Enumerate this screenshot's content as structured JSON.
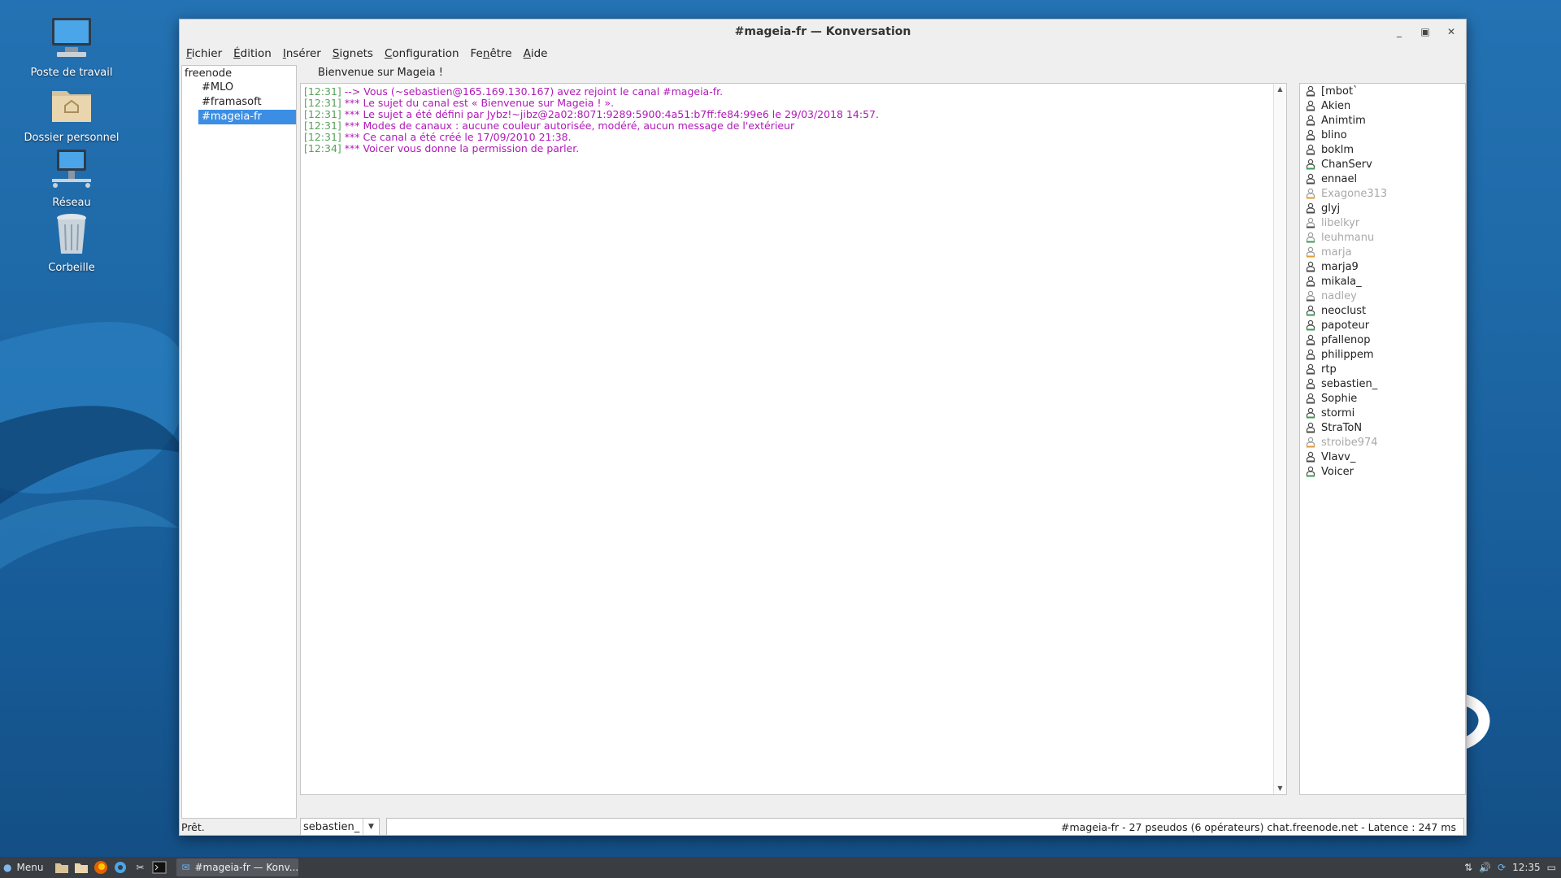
{
  "desktop": {
    "icons": [
      {
        "label": "Poste de travail",
        "icon": "computer-icon"
      },
      {
        "label": "Dossier personnel",
        "icon": "home-folder-icon"
      },
      {
        "label": "Réseau",
        "icon": "network-icon"
      },
      {
        "label": "Corbeille",
        "icon": "trash-icon"
      }
    ]
  },
  "window": {
    "title": "#mageia-fr — Konversation",
    "controls": [
      "minimize",
      "maximize",
      "close"
    ]
  },
  "menubar": [
    {
      "accel": "F",
      "rest": "ichier"
    },
    {
      "accel": "É",
      "rest": "dition"
    },
    {
      "accel": "I",
      "rest": "nsérer"
    },
    {
      "accel": "S",
      "rest": "ignets"
    },
    {
      "accel": "C",
      "rest": "onfiguration"
    },
    {
      "accel": "F",
      "rest": "enêtre",
      "pre": "Fe",
      "accel2": "n"
    },
    {
      "accel": "A",
      "rest": "ide"
    }
  ],
  "tree": {
    "server": "freenode",
    "channels": [
      "#MLO",
      "#framasoft",
      "#mageia-fr"
    ],
    "selected": "#mageia-fr"
  },
  "topic": "Bienvenue sur Mageia !",
  "chat": {
    "lines": [
      {
        "time": "[12:31]",
        "text": "--> Vous (~sebastien@165.169.130.167) avez rejoint le canal #mageia-fr."
      },
      {
        "time": "[12:31]",
        "text": "*** Le sujet du canal est « Bienvenue sur Mageia ! »."
      },
      {
        "time": "[12:31]",
        "text": "*** Le sujet a été défini par Jybz!~jibz@2a02:8071:9289:5900:4a51:b7ff:fe84:99e6 le 29/03/2018 14:57."
      },
      {
        "time": "[12:31]",
        "text": "*** Modes de canaux : aucune couleur autorisée, modéré, aucun message de l'extérieur"
      },
      {
        "time": "[12:31]",
        "text": "*** Ce canal a été créé le 17/09/2010 21:38."
      },
      {
        "time": "[12:34]",
        "text": "*** Voicer vous donne la permission de parler."
      }
    ]
  },
  "nicklist": [
    {
      "nick": "[mbot`",
      "away": false,
      "mode": "normal"
    },
    {
      "nick": "Akien",
      "away": false,
      "mode": "normal"
    },
    {
      "nick": "Animtim",
      "away": false,
      "mode": "normal"
    },
    {
      "nick": "blino",
      "away": false,
      "mode": "normal"
    },
    {
      "nick": "boklm",
      "away": false,
      "mode": "normal"
    },
    {
      "nick": "ChanServ",
      "away": false,
      "mode": "op"
    },
    {
      "nick": "ennael",
      "away": false,
      "mode": "normal"
    },
    {
      "nick": "Exagone313",
      "away": true,
      "mode": "voice"
    },
    {
      "nick": "glyj",
      "away": false,
      "mode": "normal"
    },
    {
      "nick": "libelkyr",
      "away": true,
      "mode": "normal"
    },
    {
      "nick": "leuhmanu",
      "away": true,
      "mode": "op"
    },
    {
      "nick": "marja",
      "away": true,
      "mode": "voice"
    },
    {
      "nick": "marja9",
      "away": false,
      "mode": "normal"
    },
    {
      "nick": "mikala_",
      "away": false,
      "mode": "normal"
    },
    {
      "nick": "nadley",
      "away": true,
      "mode": "normal"
    },
    {
      "nick": "neoclust",
      "away": false,
      "mode": "op"
    },
    {
      "nick": "papoteur",
      "away": false,
      "mode": "op"
    },
    {
      "nick": "pfallenop",
      "away": false,
      "mode": "normal"
    },
    {
      "nick": "philippem",
      "away": false,
      "mode": "normal"
    },
    {
      "nick": "rtp",
      "away": false,
      "mode": "normal"
    },
    {
      "nick": "sebastien_",
      "away": false,
      "mode": "normal"
    },
    {
      "nick": "Sophie",
      "away": false,
      "mode": "normal"
    },
    {
      "nick": "stormi",
      "away": false,
      "mode": "op"
    },
    {
      "nick": "StraToN",
      "away": false,
      "mode": "normal"
    },
    {
      "nick": "stroibe974",
      "away": true,
      "mode": "voice"
    },
    {
      "nick": "Vlavv_",
      "away": false,
      "mode": "normal"
    },
    {
      "nick": "Voicer",
      "away": false,
      "mode": "op"
    }
  ],
  "input": {
    "nick": "sebastien_",
    "message": ""
  },
  "status": {
    "left": "Prêt.",
    "right": "#mageia-fr - 27 pseudos (6 opérateurs)  chat.freenode.net - Latence : 247 ms"
  },
  "taskbar": {
    "menu_label": "Menu",
    "task_label": "#mageia-fr — Konv...",
    "clock": "12:35"
  },
  "colors": {
    "timestamp": "#57a25a",
    "system_message": "#b019b8",
    "selection": "#3b8ee3",
    "nick_normal": "#4a4a4a",
    "nick_op": "#3a9b4f",
    "nick_voice": "#e39a2f"
  }
}
